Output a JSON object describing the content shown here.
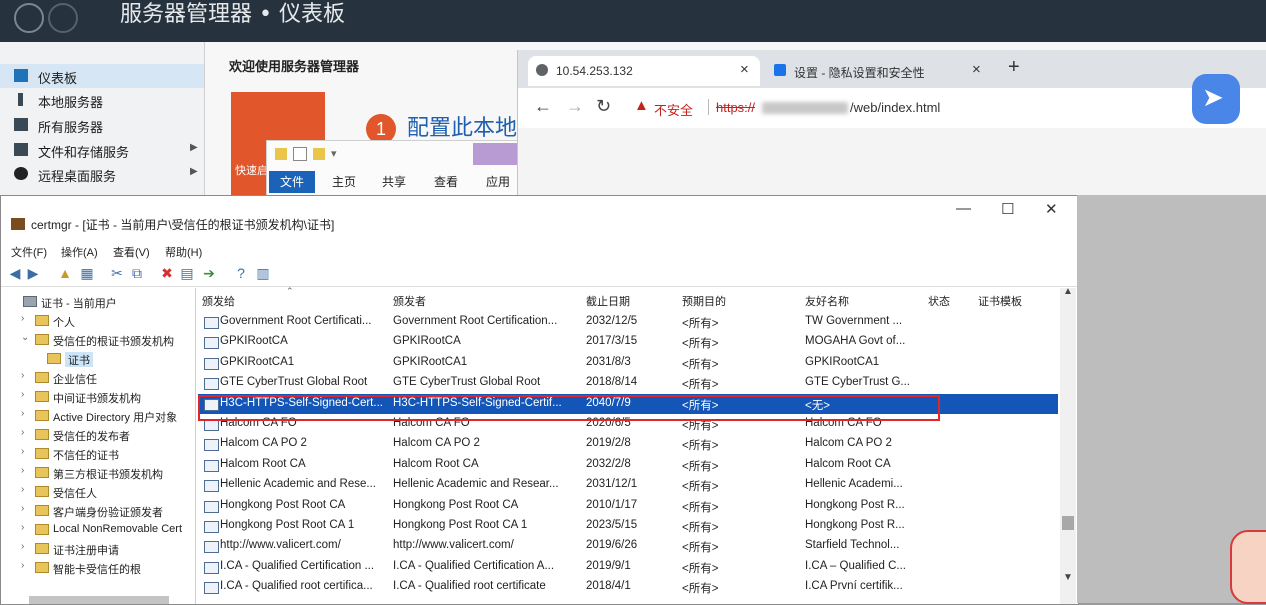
{
  "server_manager": {
    "title": "服务器管理器 • 仪表板",
    "nav": [
      {
        "label": "仪表板",
        "active": true
      },
      {
        "label": "本地服务器"
      },
      {
        "label": "所有服务器"
      },
      {
        "label": "文件和存储服务"
      },
      {
        "label": "远程桌面服务"
      }
    ],
    "welcome": "欢迎使用服务器管理器",
    "quick_start": "快速启",
    "config_num": "1",
    "config_label": "配置此本地"
  },
  "explorer": {
    "tabs": [
      "文件",
      "主页",
      "共享",
      "查看",
      "应用程"
    ]
  },
  "browser": {
    "tab1_title": "10.54.253.132",
    "tab2_title": "设置 - 隐私设置和安全性",
    "new_tab": "+",
    "close": "×",
    "not_secure": "不安全",
    "url_scheme": "https://",
    "url_path": "/web/index.html"
  },
  "certmgr": {
    "title": "certmgr - [证书 - 当前用户\\受信任的根证书颁发机构\\证书]",
    "menus": [
      "文件(F)",
      "操作(A)",
      "查看(V)",
      "帮助(H)"
    ],
    "tree": [
      {
        "label": "证书 - 当前用户",
        "indent": 0,
        "toggle": ""
      },
      {
        "label": "个人",
        "indent": 1,
        "toggle": ">"
      },
      {
        "label": "受信任的根证书颁发机构",
        "indent": 1,
        "toggle": "v"
      },
      {
        "label": "证书",
        "indent": 2,
        "toggle": "",
        "selected": true
      },
      {
        "label": "企业信任",
        "indent": 1,
        "toggle": ">"
      },
      {
        "label": "中间证书颁发机构",
        "indent": 1,
        "toggle": ">"
      },
      {
        "label": "Active Directory 用户对象",
        "indent": 1,
        "toggle": ">"
      },
      {
        "label": "受信任的发布者",
        "indent": 1,
        "toggle": ">"
      },
      {
        "label": "不信任的证书",
        "indent": 1,
        "toggle": ">"
      },
      {
        "label": "第三方根证书颁发机构",
        "indent": 1,
        "toggle": ">"
      },
      {
        "label": "受信任人",
        "indent": 1,
        "toggle": ">"
      },
      {
        "label": "客户端身份验证颁发者",
        "indent": 1,
        "toggle": ">"
      },
      {
        "label": "Local NonRemovable Cert",
        "indent": 1,
        "toggle": ">"
      },
      {
        "label": "证书注册申请",
        "indent": 1,
        "toggle": ">"
      },
      {
        "label": "智能卡受信任的根",
        "indent": 1,
        "toggle": ">"
      }
    ],
    "columns": [
      "颁发给",
      "颁发者",
      "截止日期",
      "预期目的",
      "友好名称",
      "状态",
      "证书模板"
    ],
    "rows": [
      [
        "Government Root Certificati...",
        "Government Root Certification...",
        "2032/12/5",
        "<所有>",
        "TW Government ..."
      ],
      [
        "GPKIRootCA",
        "GPKIRootCA",
        "2017/3/15",
        "<所有>",
        "MOGAHA Govt of..."
      ],
      [
        "GPKIRootCA1",
        "GPKIRootCA1",
        "2031/8/3",
        "<所有>",
        "GPKIRootCA1"
      ],
      [
        "GTE CyberTrust Global Root",
        "GTE CyberTrust Global Root",
        "2018/8/14",
        "<所有>",
        "GTE CyberTrust G..."
      ],
      [
        "H3C-HTTPS-Self-Signed-Cert...",
        "H3C-HTTPS-Self-Signed-Certif...",
        "2040/7/9",
        "<所有>",
        "<无>"
      ],
      [
        "Halcom CA FO",
        "Halcom CA FO",
        "2020/6/5",
        "<所有>",
        "Halcom CA FO"
      ],
      [
        "Halcom CA PO 2",
        "Halcom CA PO 2",
        "2019/2/8",
        "<所有>",
        "Halcom CA PO 2"
      ],
      [
        "Halcom Root CA",
        "Halcom Root CA",
        "2032/2/8",
        "<所有>",
        "Halcom Root CA"
      ],
      [
        "Hellenic Academic and Rese...",
        "Hellenic Academic and Resear...",
        "2031/12/1",
        "<所有>",
        "Hellenic Academi..."
      ],
      [
        "Hongkong Post Root CA",
        "Hongkong Post Root CA",
        "2010/1/17",
        "<所有>",
        "Hongkong Post R..."
      ],
      [
        "Hongkong Post Root CA 1",
        "Hongkong Post Root CA 1",
        "2023/5/15",
        "<所有>",
        "Hongkong Post R..."
      ],
      [
        "http://www.valicert.com/",
        "http://www.valicert.com/",
        "2019/6/26",
        "<所有>",
        "Starfield Technol..."
      ],
      [
        "I.CA - Qualified Certification ...",
        "I.CA - Qualified Certification A...",
        "2019/9/1",
        "<所有>",
        "I.CA – Qualified C..."
      ],
      [
        "I.CA - Qualified root certifica...",
        "I.CA - Qualified root certificate",
        "2018/4/1",
        "<所有>",
        "I.CA První certifik..."
      ]
    ],
    "selected_row": 4
  }
}
